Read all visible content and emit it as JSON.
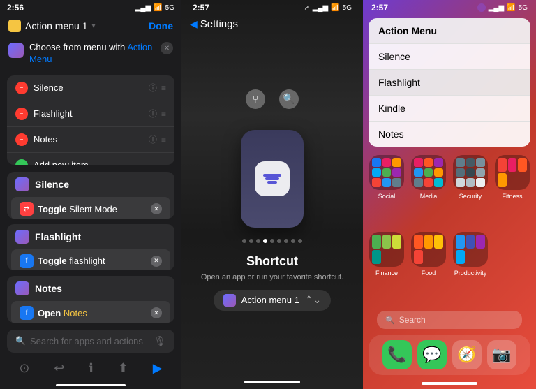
{
  "panel1": {
    "status_time": "2:56",
    "signal": "▂▄▆",
    "wifi": "WiFi",
    "battery": "5G",
    "shortcut_name": "Action menu 1",
    "done_label": "Done",
    "choose_label": "Choose from menu with",
    "action_label": "Action Menu",
    "menu_items": [
      {
        "label": "Silence",
        "color": "red"
      },
      {
        "label": "Flashlight",
        "color": "red"
      },
      {
        "label": "Notes",
        "color": "red"
      },
      {
        "label": "Add new item",
        "color": "green"
      }
    ],
    "silence_header": "Silence",
    "silence_action": "Toggle",
    "silence_action2": "Silent Mode",
    "flashlight_header": "Flashlight",
    "flashlight_action": "Toggle",
    "flashlight_action2": "flashlight",
    "notes_header": "Notes",
    "notes_action": "Open",
    "notes_action2": "Notes",
    "search_placeholder": "Search for apps and actions",
    "toolbar_items": [
      "⊙",
      "↩",
      "ℹ",
      "↑",
      "▶"
    ]
  },
  "panel2": {
    "status_time": "2:57",
    "back_label": "Settings",
    "widget_title": "Shortcut",
    "widget_desc": "Open an app or run your favorite shortcut.",
    "action_label": "Action menu 1"
  },
  "panel3": {
    "status_time": "2:57",
    "menu_items": [
      {
        "label": "Action Menu"
      },
      {
        "label": "Silence"
      },
      {
        "label": "Flashlight"
      },
      {
        "label": "Kindle"
      },
      {
        "label": "Notes"
      }
    ],
    "folders": [
      {
        "label": "Social"
      },
      {
        "label": "Media"
      },
      {
        "label": "Security"
      },
      {
        "label": "Fitness"
      },
      {
        "label": "Finance"
      },
      {
        "label": "Food"
      },
      {
        "label": "Productivity"
      },
      {
        "label": ""
      }
    ],
    "search_placeholder": "Search",
    "dock_icons": [
      "📞",
      "💬",
      "🧭",
      "📷"
    ]
  }
}
